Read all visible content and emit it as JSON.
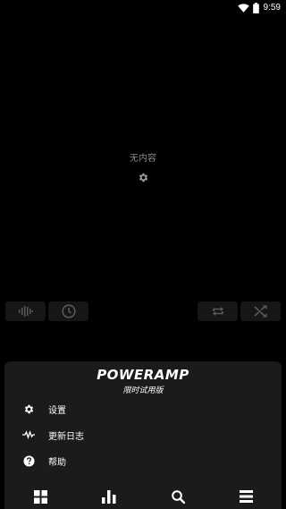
{
  "status_bar": {
    "time": "9:59",
    "icons": [
      "wifi-icon",
      "battery-icon"
    ]
  },
  "empty_state": {
    "text": "无内容",
    "icon": "gear-icon"
  },
  "controls": {
    "left": [
      "waveform-icon",
      "clock-icon"
    ],
    "right": [
      "repeat-icon",
      "shuffle-icon"
    ]
  },
  "menu": {
    "logo_text": "POWERAMP",
    "logo_subtitle": "限时试用版",
    "items": [
      {
        "label": "设置",
        "icon": "gear-icon"
      },
      {
        "label": "更新日志",
        "icon": "pulse-icon"
      },
      {
        "label": "帮助",
        "icon": "help-icon"
      }
    ]
  },
  "bottom_nav": [
    "library-icon",
    "equalizer-icon",
    "search-icon",
    "menu-icon"
  ],
  "colors": {
    "background": "#000000",
    "sheet": "#1b1b1b",
    "control_button": "#161616",
    "muted_text": "#8a8a8a",
    "icon_dim": "#555555"
  }
}
